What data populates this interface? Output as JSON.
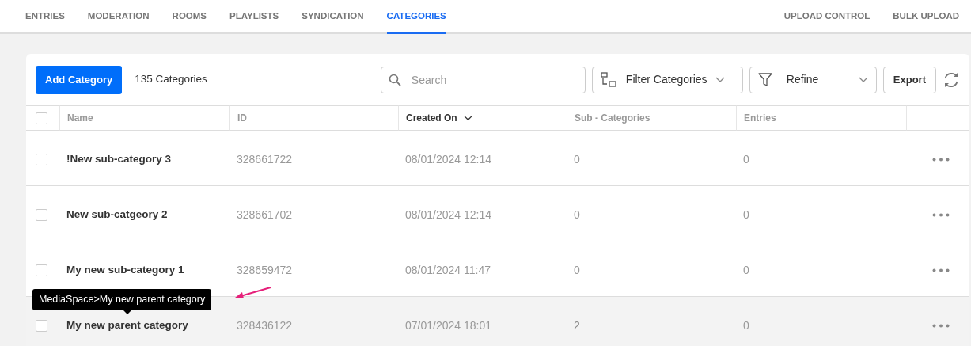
{
  "nav": {
    "tabs": [
      {
        "label": "ENTRIES",
        "selected": false
      },
      {
        "label": "MODERATION",
        "selected": false
      },
      {
        "label": "ROOMS",
        "selected": false
      },
      {
        "label": "PLAYLISTS",
        "selected": false
      },
      {
        "label": "SYNDICATION",
        "selected": false
      },
      {
        "label": "CATEGORIES",
        "selected": true
      }
    ],
    "right_links": [
      "UPLOAD CONTROL",
      "BULK UPLOAD"
    ]
  },
  "toolbar": {
    "add_button": "Add Category",
    "count": "135 Categories",
    "search": {
      "placeholder": "Search"
    },
    "filter": "Filter Categories",
    "refine": "Refine",
    "export": "Export"
  },
  "table": {
    "select_all_checked": false,
    "columns": [
      {
        "label": "Name",
        "sorted": false
      },
      {
        "label": "ID",
        "sorted": false
      },
      {
        "label": "Created On",
        "sorted": true
      },
      {
        "label": "Sub - Categories",
        "sorted": false
      },
      {
        "label": "Entries",
        "sorted": false
      }
    ],
    "rows": [
      {
        "name": "!New sub-category 3",
        "id": "328661722",
        "created": "08/01/2024 12:14",
        "subcategories": "0",
        "entries": "0",
        "checked": false,
        "hovered": false
      },
      {
        "name": "New sub-catgeory 2",
        "id": "328661702",
        "created": "08/01/2024 12:14",
        "subcategories": "0",
        "entries": "0",
        "checked": false,
        "hovered": false
      },
      {
        "name": "My new sub-category 1",
        "id": "328659472",
        "created": "08/01/2024 11:47",
        "subcategories": "0",
        "entries": "0",
        "checked": false,
        "hovered": false
      },
      {
        "name": "My new parent category",
        "id": "328436122",
        "created": "07/01/2024 18:01",
        "subcategories": "2",
        "entries": "0",
        "checked": false,
        "hovered": true,
        "tooltip": "MediaSpace>My new parent category"
      }
    ]
  }
}
